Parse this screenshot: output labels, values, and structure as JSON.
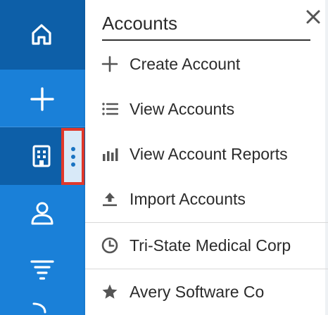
{
  "sidebar": {
    "items": [
      {
        "name": "home",
        "icon": "home-icon"
      },
      {
        "name": "quick-create",
        "icon": "plus-icon"
      },
      {
        "name": "accounts",
        "icon": "building-icon"
      },
      {
        "name": "contacts",
        "icon": "person-icon"
      },
      {
        "name": "filter",
        "icon": "filter-icon"
      }
    ],
    "accent": "#1a80d8",
    "active": "#0d5fa8",
    "highlight_border": "#e0382b"
  },
  "menu": {
    "title": "Accounts",
    "actions": [
      {
        "label": "Create Account",
        "icon": "plus-icon"
      },
      {
        "label": "View Accounts",
        "icon": "list-icon"
      },
      {
        "label": "View Account Reports",
        "icon": "bar-chart-icon"
      },
      {
        "label": "Import Accounts",
        "icon": "upload-icon"
      }
    ],
    "recent": {
      "label": "Tri-State Medical Corp",
      "icon": "clock-icon"
    },
    "favorite": {
      "label": "Avery Software Co",
      "icon": "star-icon"
    }
  }
}
